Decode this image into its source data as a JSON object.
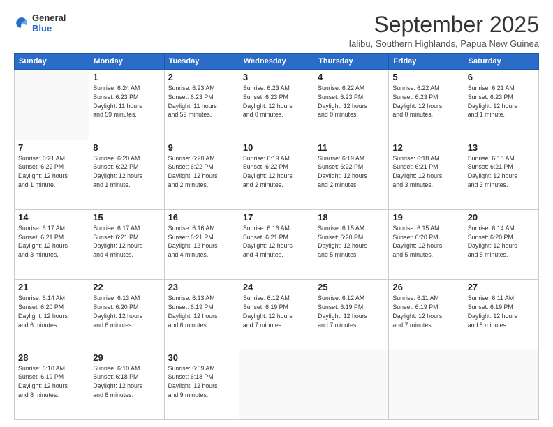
{
  "logo": {
    "line1": "General",
    "line2": "Blue"
  },
  "title": "September 2025",
  "subtitle": "Ialibu, Southern Highlands, Papua New Guinea",
  "days_header": [
    "Sunday",
    "Monday",
    "Tuesday",
    "Wednesday",
    "Thursday",
    "Friday",
    "Saturday"
  ],
  "weeks": [
    [
      {
        "day": "",
        "info": ""
      },
      {
        "day": "1",
        "info": "Sunrise: 6:24 AM\nSunset: 6:23 PM\nDaylight: 11 hours\nand 59 minutes."
      },
      {
        "day": "2",
        "info": "Sunrise: 6:23 AM\nSunset: 6:23 PM\nDaylight: 11 hours\nand 59 minutes."
      },
      {
        "day": "3",
        "info": "Sunrise: 6:23 AM\nSunset: 6:23 PM\nDaylight: 12 hours\nand 0 minutes."
      },
      {
        "day": "4",
        "info": "Sunrise: 6:22 AM\nSunset: 6:23 PM\nDaylight: 12 hours\nand 0 minutes."
      },
      {
        "day": "5",
        "info": "Sunrise: 6:22 AM\nSunset: 6:23 PM\nDaylight: 12 hours\nand 0 minutes."
      },
      {
        "day": "6",
        "info": "Sunrise: 6:21 AM\nSunset: 6:23 PM\nDaylight: 12 hours\nand 1 minute."
      }
    ],
    [
      {
        "day": "7",
        "info": "Sunrise: 6:21 AM\nSunset: 6:22 PM\nDaylight: 12 hours\nand 1 minute."
      },
      {
        "day": "8",
        "info": "Sunrise: 6:20 AM\nSunset: 6:22 PM\nDaylight: 12 hours\nand 1 minute."
      },
      {
        "day": "9",
        "info": "Sunrise: 6:20 AM\nSunset: 6:22 PM\nDaylight: 12 hours\nand 2 minutes."
      },
      {
        "day": "10",
        "info": "Sunrise: 6:19 AM\nSunset: 6:22 PM\nDaylight: 12 hours\nand 2 minutes."
      },
      {
        "day": "11",
        "info": "Sunrise: 6:19 AM\nSunset: 6:22 PM\nDaylight: 12 hours\nand 2 minutes."
      },
      {
        "day": "12",
        "info": "Sunrise: 6:18 AM\nSunset: 6:21 PM\nDaylight: 12 hours\nand 3 minutes."
      },
      {
        "day": "13",
        "info": "Sunrise: 6:18 AM\nSunset: 6:21 PM\nDaylight: 12 hours\nand 3 minutes."
      }
    ],
    [
      {
        "day": "14",
        "info": "Sunrise: 6:17 AM\nSunset: 6:21 PM\nDaylight: 12 hours\nand 3 minutes."
      },
      {
        "day": "15",
        "info": "Sunrise: 6:17 AM\nSunset: 6:21 PM\nDaylight: 12 hours\nand 4 minutes."
      },
      {
        "day": "16",
        "info": "Sunrise: 6:16 AM\nSunset: 6:21 PM\nDaylight: 12 hours\nand 4 minutes."
      },
      {
        "day": "17",
        "info": "Sunrise: 6:16 AM\nSunset: 6:21 PM\nDaylight: 12 hours\nand 4 minutes."
      },
      {
        "day": "18",
        "info": "Sunrise: 6:15 AM\nSunset: 6:20 PM\nDaylight: 12 hours\nand 5 minutes."
      },
      {
        "day": "19",
        "info": "Sunrise: 6:15 AM\nSunset: 6:20 PM\nDaylight: 12 hours\nand 5 minutes."
      },
      {
        "day": "20",
        "info": "Sunrise: 6:14 AM\nSunset: 6:20 PM\nDaylight: 12 hours\nand 5 minutes."
      }
    ],
    [
      {
        "day": "21",
        "info": "Sunrise: 6:14 AM\nSunset: 6:20 PM\nDaylight: 12 hours\nand 6 minutes."
      },
      {
        "day": "22",
        "info": "Sunrise: 6:13 AM\nSunset: 6:20 PM\nDaylight: 12 hours\nand 6 minutes."
      },
      {
        "day": "23",
        "info": "Sunrise: 6:13 AM\nSunset: 6:19 PM\nDaylight: 12 hours\nand 6 minutes."
      },
      {
        "day": "24",
        "info": "Sunrise: 6:12 AM\nSunset: 6:19 PM\nDaylight: 12 hours\nand 7 minutes."
      },
      {
        "day": "25",
        "info": "Sunrise: 6:12 AM\nSunset: 6:19 PM\nDaylight: 12 hours\nand 7 minutes."
      },
      {
        "day": "26",
        "info": "Sunrise: 6:11 AM\nSunset: 6:19 PM\nDaylight: 12 hours\nand 7 minutes."
      },
      {
        "day": "27",
        "info": "Sunrise: 6:11 AM\nSunset: 6:19 PM\nDaylight: 12 hours\nand 8 minutes."
      }
    ],
    [
      {
        "day": "28",
        "info": "Sunrise: 6:10 AM\nSunset: 6:19 PM\nDaylight: 12 hours\nand 8 minutes."
      },
      {
        "day": "29",
        "info": "Sunrise: 6:10 AM\nSunset: 6:18 PM\nDaylight: 12 hours\nand 8 minutes."
      },
      {
        "day": "30",
        "info": "Sunrise: 6:09 AM\nSunset: 6:18 PM\nDaylight: 12 hours\nand 9 minutes."
      },
      {
        "day": "",
        "info": ""
      },
      {
        "day": "",
        "info": ""
      },
      {
        "day": "",
        "info": ""
      },
      {
        "day": "",
        "info": ""
      }
    ]
  ]
}
